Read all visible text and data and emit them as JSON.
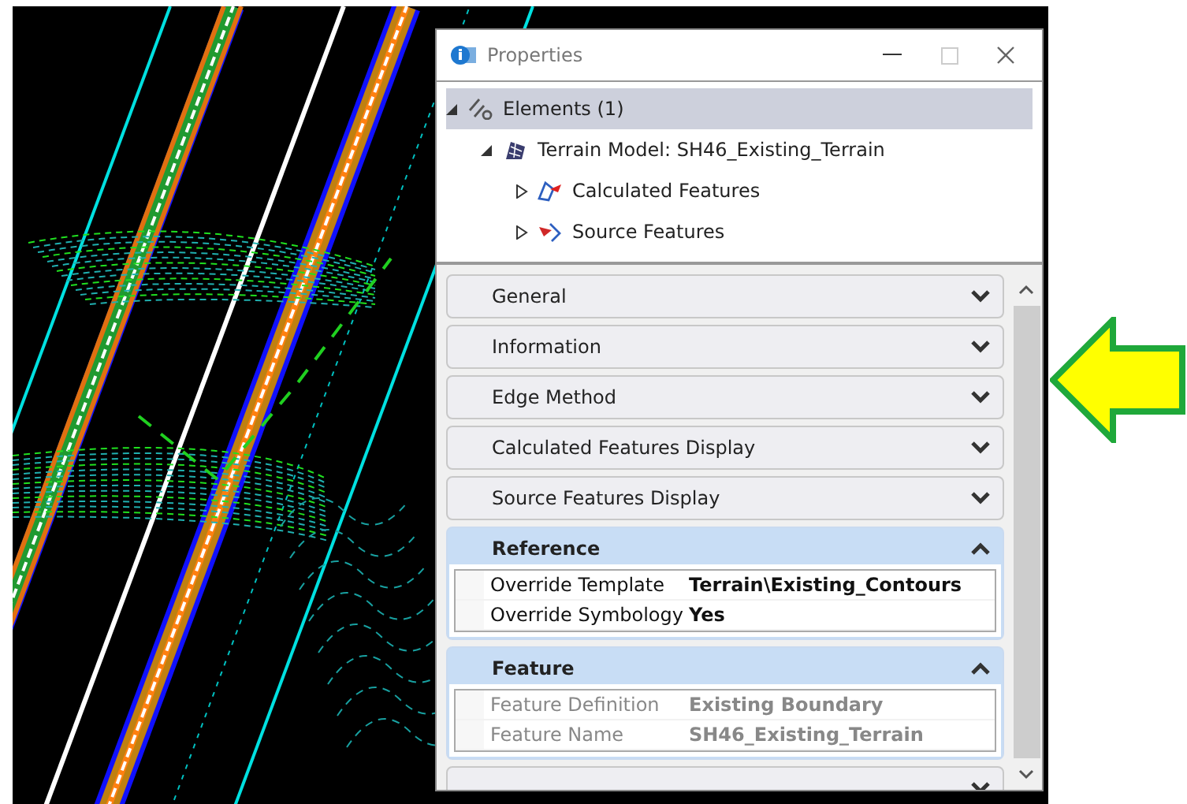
{
  "window": {
    "title": "Properties"
  },
  "tree": [
    {
      "label": "Elements (1)",
      "kind": "elements",
      "expanded": true,
      "selected": true,
      "children": [
        {
          "label": "Terrain Model: SH46_Existing_Terrain",
          "kind": "terrain",
          "expanded": true,
          "selected": false,
          "children": [
            {
              "label": "Calculated Features",
              "kind": "calculated",
              "expanded": false,
              "selected": false
            },
            {
              "label": "Source Features",
              "kind": "source",
              "expanded": false,
              "selected": false
            }
          ]
        }
      ]
    }
  ],
  "sections": [
    {
      "title": "General",
      "expanded": false
    },
    {
      "title": "Information",
      "expanded": false
    },
    {
      "title": "Edge Method",
      "expanded": false
    },
    {
      "title": "Calculated Features Display",
      "expanded": false
    },
    {
      "title": "Source Features Display",
      "expanded": false
    },
    {
      "title": "Reference",
      "expanded": true,
      "rows": [
        {
          "name": "Override Template",
          "value": "Terrain\\Existing_Contours",
          "disabled": false
        },
        {
          "name": "Override Symbology",
          "value": "Yes",
          "disabled": false
        }
      ]
    },
    {
      "title": "Feature",
      "expanded": true,
      "rows": [
        {
          "name": "Feature Definition",
          "value": "Existing Boundary",
          "disabled": true
        },
        {
          "name": "Feature Name",
          "value": "SH46_Existing_Terrain",
          "disabled": true
        }
      ]
    },
    {
      "expanded": false
    }
  ]
}
